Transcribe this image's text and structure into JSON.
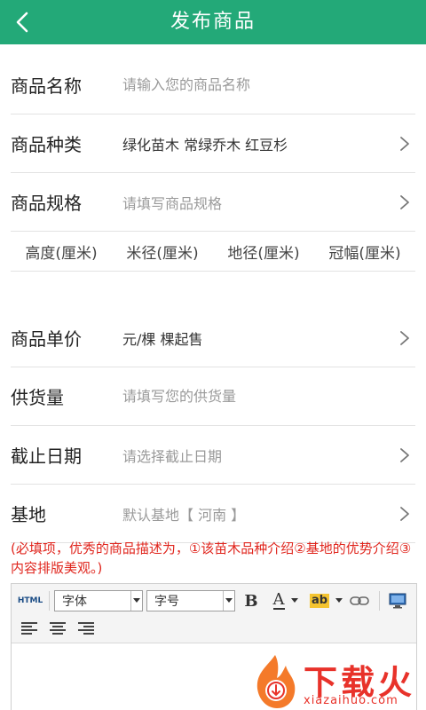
{
  "header": {
    "title": "发布商品"
  },
  "form": {
    "name": {
      "label": "商品名称",
      "placeholder": "请输入您的商品名称"
    },
    "category": {
      "label": "商品种类",
      "value": "绿化苗木 常绿乔木 红豆杉"
    },
    "spec": {
      "label": "商品规格",
      "placeholder": "请填写商品规格"
    },
    "spec_columns": [
      "高度(厘米)",
      "米径(厘米)",
      "地径(厘米)",
      "冠幅(厘米)"
    ],
    "price": {
      "label": "商品单价",
      "value": "元/棵  棵起售"
    },
    "supply": {
      "label": "供货量",
      "placeholder": "请填写您的供货量"
    },
    "deadline": {
      "label": "截止日期",
      "placeholder": "请选择截止日期"
    },
    "base": {
      "label": "基地",
      "value": "默认基地【 河南 】"
    }
  },
  "notice": "(必填项，优秀的商品描述为，①该苗木品种介绍②基地的优势介绍③内容排版美观。)",
  "editor": {
    "html_label": "HTML",
    "font_label": "字体",
    "size_label": "字号",
    "bold_label": "B",
    "font_color_label": "A",
    "highlight_label": "ab"
  },
  "watermark": {
    "text": "下载火",
    "sub": "xiazaihuo.com"
  },
  "colors": {
    "header_bg": "#23a978",
    "notice": "#e0261e",
    "watermark": "#e8322a"
  }
}
